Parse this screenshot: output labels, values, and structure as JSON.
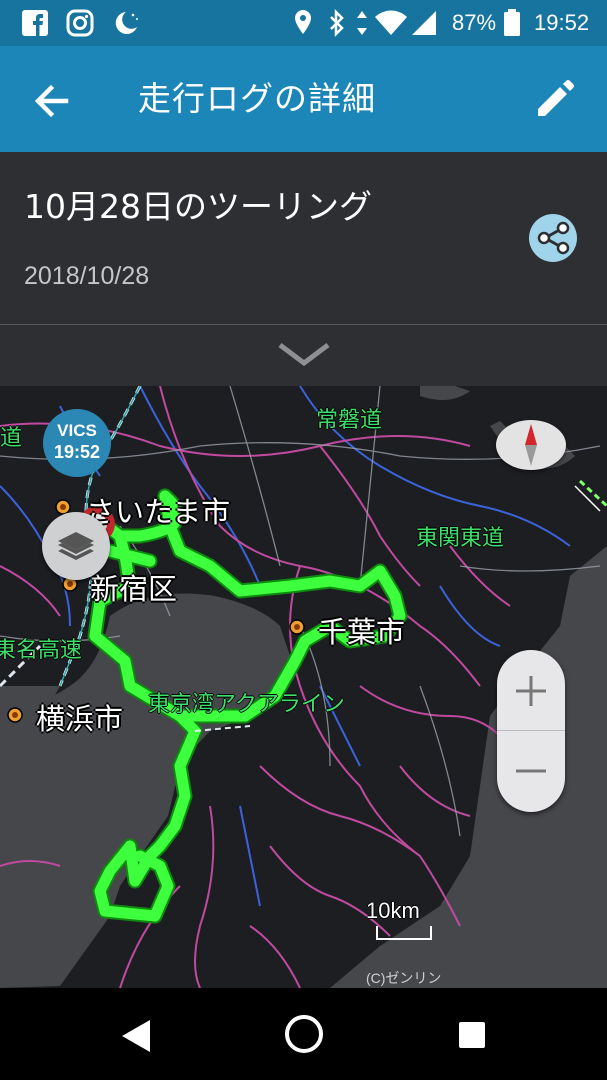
{
  "status_bar": {
    "battery": "87%",
    "time": "19:52",
    "icons": [
      "facebook-icon",
      "instagram-icon",
      "night-mode-icon",
      "location-icon",
      "bluetooth-icon",
      "data-arrows-icon",
      "wifi-icon",
      "signal-icon",
      "battery-icon"
    ]
  },
  "app_bar": {
    "title": "走行ログの詳細",
    "back_icon": "arrow-back-icon",
    "edit_icon": "pencil-icon",
    "color": "#1c86b8"
  },
  "trip": {
    "title": "10月28日のツーリング",
    "date": "2018/10/28",
    "share_icon": "share-icon",
    "expand_icon": "chevron-down-icon"
  },
  "map": {
    "vics": {
      "label": "VICS",
      "time": "19:52"
    },
    "cities": [
      "さいたま市",
      "新宿区",
      "千葉市",
      "横浜市"
    ],
    "roads": [
      "常磐道",
      "東関東道",
      "東名高速",
      "東京湾アクアライン",
      "道"
    ],
    "route_color": "#39ff39",
    "scale": "10km",
    "copyright": "(C)ゼンリン",
    "zoom_in": "+",
    "zoom_out": "−"
  },
  "nav_bar": {
    "icons": [
      "back-triangle-icon",
      "home-circle-icon",
      "recents-square-icon"
    ]
  }
}
